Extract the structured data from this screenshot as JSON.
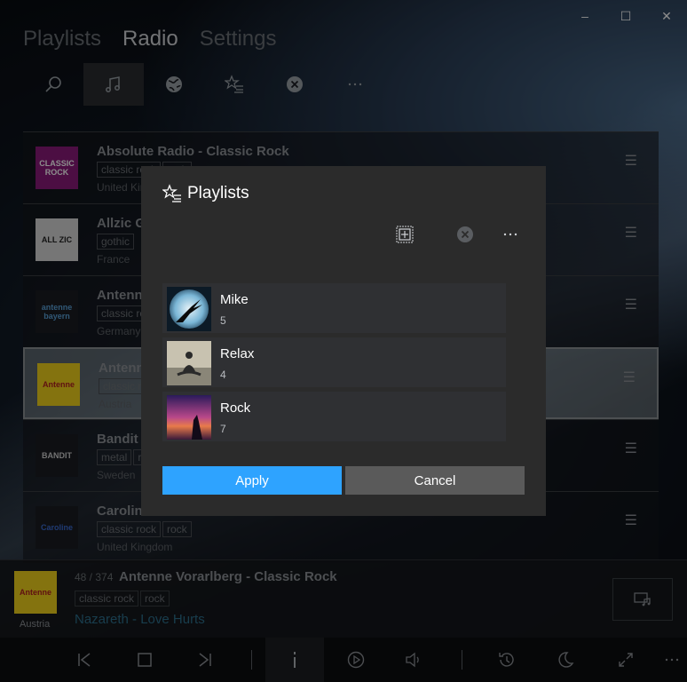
{
  "window": {
    "minimize": "–",
    "maximize": "☐",
    "close": "✕"
  },
  "nav": {
    "playlists": "Playlists",
    "radio": "Radio",
    "settings": "Settings"
  },
  "toolbar": [
    "search-icon",
    "music-note-icon",
    "globe-icon",
    "favorite-list-icon",
    "close-circle-icon",
    "more-icon"
  ],
  "stations": [
    {
      "name": "Absolute Radio - Classic Rock",
      "tags": [
        "classic rock",
        "rock"
      ],
      "country": "United Kingdom",
      "logo": "CLASSIC ROCK",
      "logo_bg": "#8a1a7a",
      "logo_fg": "#ffffff"
    },
    {
      "name": "Allzic Gothic",
      "tags": [
        "gothic"
      ],
      "country": "France",
      "logo": "ALL ZIC",
      "logo_bg": "#d8d8d8",
      "logo_fg": "#222222"
    },
    {
      "name": "Antenne Bayern",
      "tags": [
        "classic rock"
      ],
      "country": "Germany",
      "logo": "antenne bayern",
      "logo_bg": "#1a1d22",
      "logo_fg": "#5aa0d8"
    },
    {
      "name": "Antenne Vorarlberg",
      "tags": [
        "classic rock"
      ],
      "country": "Austria",
      "logo": "Antenne",
      "logo_bg": "#f0d21c",
      "logo_fg": "#b02020"
    },
    {
      "name": "Bandit Metal",
      "tags": [
        "metal",
        "rock"
      ],
      "country": "Sweden",
      "logo": "BANDIT",
      "logo_bg": "#1a1d22",
      "logo_fg": "#d0d0d0"
    },
    {
      "name": "Caroline",
      "tags": [
        "classic rock",
        "rock"
      ],
      "country": "United Kingdom",
      "logo": "Caroline",
      "logo_bg": "#1a1d22",
      "logo_fg": "#3a6ad0"
    }
  ],
  "now_playing": {
    "count": "48 / 374",
    "title": "Antenne Vorarlberg - Classic Rock",
    "tags": [
      "classic rock",
      "rock"
    ],
    "track": "Nazareth - Love Hurts",
    "country": "Austria",
    "logo": "Antenne"
  },
  "transport": [
    "previous-icon",
    "stop-icon",
    "next-icon",
    "info-icon",
    "play-circle-icon",
    "volume-icon",
    "history-icon",
    "sleep-icon",
    "fullscreen-icon",
    "more-icon"
  ],
  "dialog": {
    "title": "Playlists",
    "playlists": [
      {
        "name": "Mike",
        "count": "5",
        "thumb": "bird"
      },
      {
        "name": "Relax",
        "count": "4",
        "thumb": "meditation"
      },
      {
        "name": "Rock",
        "count": "7",
        "thumb": "sunset"
      }
    ],
    "apply": "Apply",
    "cancel": "Cancel"
  },
  "colors": {
    "accent": "#2ea3ff",
    "cancel": "#5a5a5a",
    "dialog_bg": "#2b2b2b"
  }
}
